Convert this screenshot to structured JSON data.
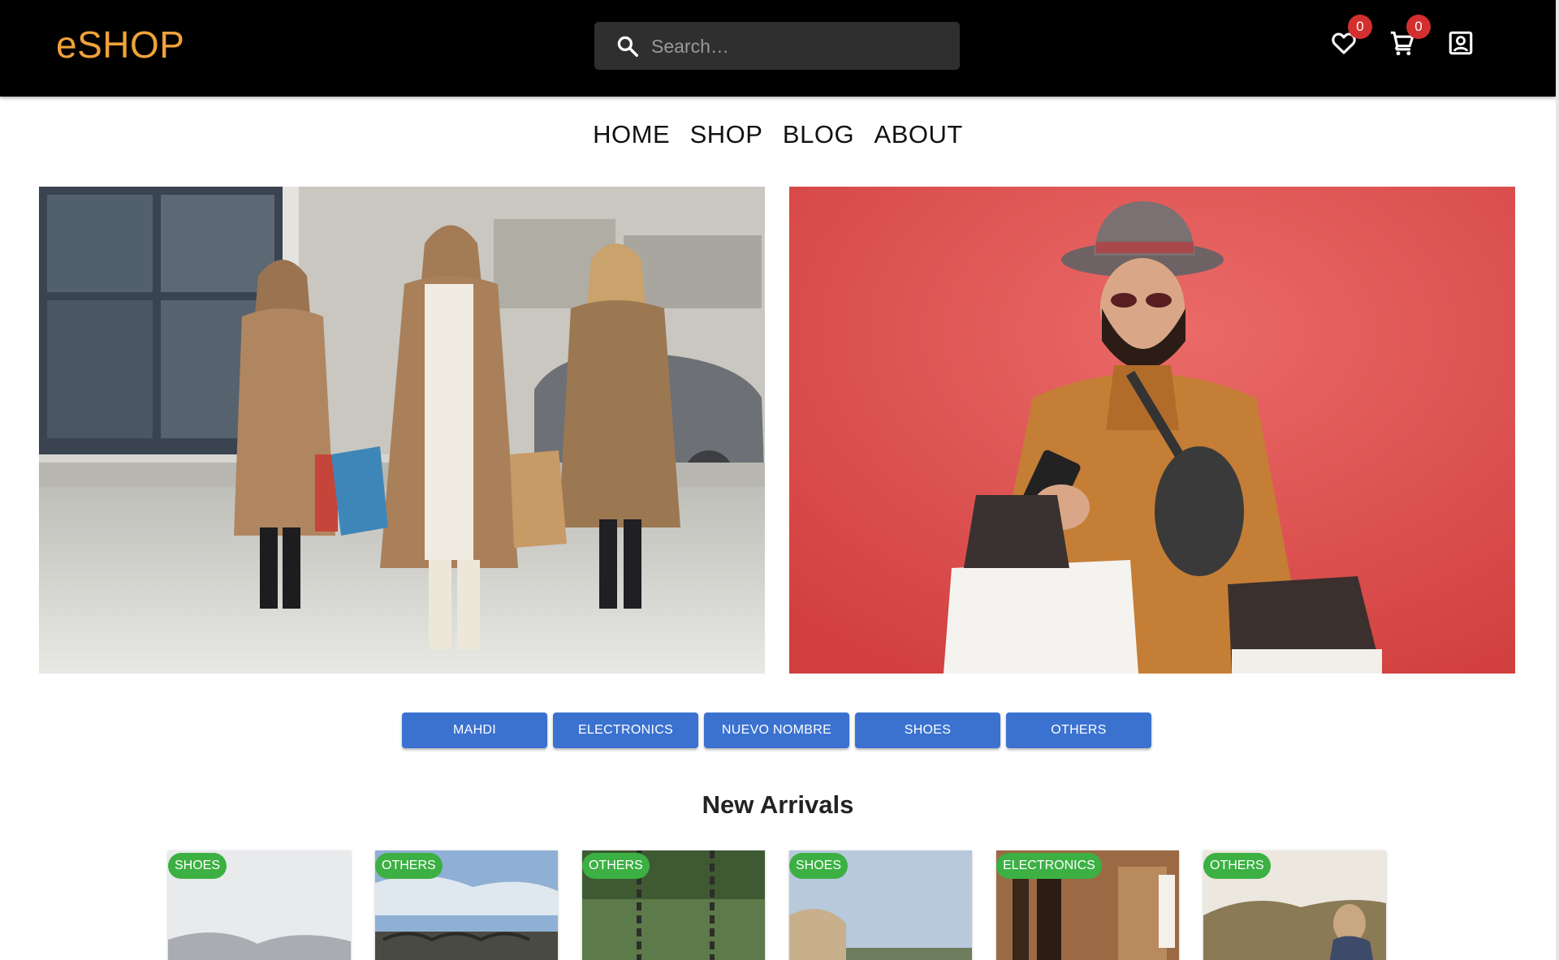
{
  "header": {
    "logo": "eSHOP",
    "search_placeholder": "Search…",
    "wishlist_count": "0",
    "cart_count": "0",
    "brand_color": "#f0a23a"
  },
  "nav": {
    "items": [
      "HOME",
      "SHOP",
      "BLOG",
      "ABOUT"
    ]
  },
  "categories": [
    "MAHDI",
    "ELECTRONICS",
    "NUEVO NOMBRE",
    "SHOES",
    "OTHERS"
  ],
  "new_arrivals": {
    "title": "New Arrivals",
    "products": [
      {
        "tag": "SHOES"
      },
      {
        "tag": "OTHERS"
      },
      {
        "tag": "OTHERS"
      },
      {
        "tag": "SHOES"
      },
      {
        "tag": "ELECTRONICS"
      },
      {
        "tag": "OTHERS"
      }
    ]
  },
  "icons": [
    "search-icon",
    "heart-icon",
    "cart-icon",
    "account-icon"
  ],
  "colors": {
    "category_button": "#3b72d0",
    "tag": "#3cb043",
    "badge": "#d32f2f"
  }
}
